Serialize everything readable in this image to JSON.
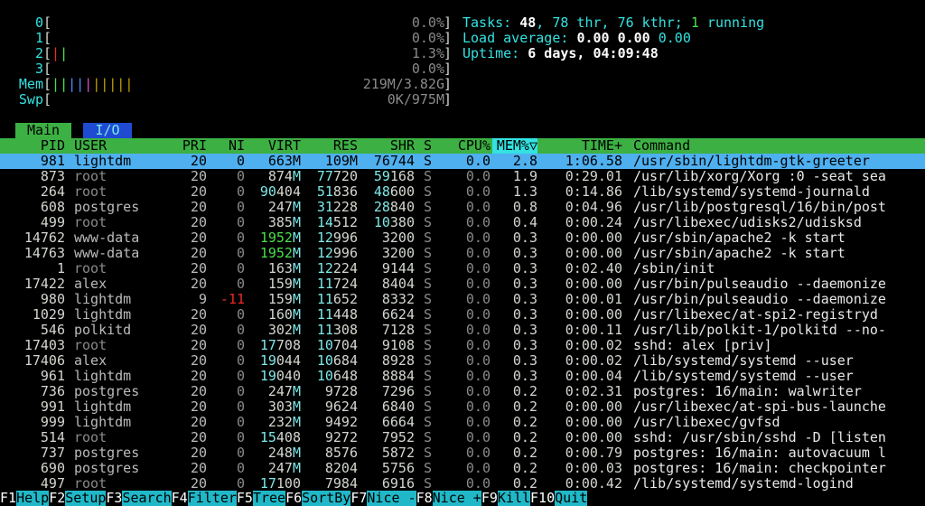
{
  "cpu_meters": [
    {
      "label": "0",
      "percent": "0.0%"
    },
    {
      "label": "1",
      "percent": "0.0%"
    },
    {
      "label": "2",
      "percent": "1.3%"
    },
    {
      "label": "3",
      "percent": "0.0%"
    }
  ],
  "mem_meter": {
    "label": "Mem",
    "value": "219M/3.82G"
  },
  "swp_meter": {
    "label": "Swp",
    "value": "0K/975M"
  },
  "tasks": {
    "label": "Tasks: ",
    "tasks": "48",
    "sep1": ", ",
    "threads": "78 thr, 76 kthr; ",
    "running": "1",
    "running_label": " running"
  },
  "load": {
    "label": "Load average: ",
    "l1": "0.00",
    "l5": "0.00",
    "l15": "0.00"
  },
  "uptime": {
    "label": "Uptime: ",
    "value": "6 days, 04:09:48"
  },
  "tabs": [
    {
      "label": "Main"
    },
    {
      "label": "I/O"
    }
  ],
  "columns": [
    "PID",
    "USER",
    "PRI",
    "NI",
    "VIRT",
    "RES",
    "SHR",
    "S",
    "CPU%",
    "MEM%▽",
    "TIME+",
    "Command"
  ],
  "processes": [
    {
      "pid": "981",
      "user": "lightdm",
      "pri": "20",
      "ni": "0",
      "virt": "663M",
      "res": "109M",
      "shr": "76744",
      "s": "S",
      "cpu": "0.0",
      "mem": "2.8",
      "time": "1:06.58",
      "cmd": "/usr/sbin/lightdm-gtk-greeter",
      "selected": true
    },
    {
      "pid": "873",
      "user": "root",
      "pri": "20",
      "ni": "0",
      "virt": "874M",
      "res": "77720",
      "shr": "59168",
      "s": "S",
      "cpu": "0.0",
      "mem": "1.9",
      "time": "0:29.01",
      "cmd": "/usr/lib/xorg/Xorg :0 -seat sea"
    },
    {
      "pid": "264",
      "user": "root",
      "pri": "20",
      "ni": "0",
      "virt": "90404",
      "res": "51836",
      "shr": "48600",
      "s": "S",
      "cpu": "0.0",
      "mem": "1.3",
      "time": "0:14.86",
      "cmd": "/lib/systemd/systemd-journald"
    },
    {
      "pid": "608",
      "user": "postgres",
      "pri": "20",
      "ni": "0",
      "virt": "247M",
      "res": "31228",
      "shr": "28840",
      "s": "S",
      "cpu": "0.0",
      "mem": "0.8",
      "time": "0:04.96",
      "cmd": "/usr/lib/postgresql/16/bin/post"
    },
    {
      "pid": "499",
      "user": "root",
      "pri": "20",
      "ni": "0",
      "virt": "385M",
      "res": "14512",
      "shr": "10380",
      "s": "S",
      "cpu": "0.0",
      "mem": "0.4",
      "time": "0:00.24",
      "cmd": "/usr/libexec/udisks2/udisksd"
    },
    {
      "pid": "14762",
      "user": "www-data",
      "pri": "20",
      "ni": "0",
      "virt": "1952M",
      "res": "12996",
      "shr": "3200",
      "s": "S",
      "cpu": "0.0",
      "mem": "0.3",
      "time": "0:00.00",
      "cmd": "/usr/sbin/apache2 -k start"
    },
    {
      "pid": "14763",
      "user": "www-data",
      "pri": "20",
      "ni": "0",
      "virt": "1952M",
      "res": "12996",
      "shr": "3200",
      "s": "S",
      "cpu": "0.0",
      "mem": "0.3",
      "time": "0:00.00",
      "cmd": "/usr/sbin/apache2 -k start"
    },
    {
      "pid": "1",
      "user": "root",
      "pri": "20",
      "ni": "0",
      "virt": "163M",
      "res": "12224",
      "shr": "9144",
      "s": "S",
      "cpu": "0.0",
      "mem": "0.3",
      "time": "0:02.40",
      "cmd": "/sbin/init"
    },
    {
      "pid": "17422",
      "user": "alex",
      "pri": "20",
      "ni": "0",
      "virt": "159M",
      "res": "11724",
      "shr": "8404",
      "s": "S",
      "cpu": "0.0",
      "mem": "0.3",
      "time": "0:00.00",
      "cmd": "/usr/bin/pulseaudio --daemonize"
    },
    {
      "pid": "980",
      "user": "lightdm",
      "pri": "9",
      "ni": "-11",
      "virt": "159M",
      "res": "11652",
      "shr": "8332",
      "s": "S",
      "cpu": "0.0",
      "mem": "0.3",
      "time": "0:00.01",
      "cmd": "/usr/bin/pulseaudio --daemonize"
    },
    {
      "pid": "1029",
      "user": "lightdm",
      "pri": "20",
      "ni": "0",
      "virt": "160M",
      "res": "11448",
      "shr": "6624",
      "s": "S",
      "cpu": "0.0",
      "mem": "0.3",
      "time": "0:00.00",
      "cmd": "/usr/libexec/at-spi2-registryd"
    },
    {
      "pid": "546",
      "user": "polkitd",
      "pri": "20",
      "ni": "0",
      "virt": "302M",
      "res": "11308",
      "shr": "7128",
      "s": "S",
      "cpu": "0.0",
      "mem": "0.3",
      "time": "0:00.11",
      "cmd": "/usr/lib/polkit-1/polkitd --no-"
    },
    {
      "pid": "17403",
      "user": "root",
      "pri": "20",
      "ni": "0",
      "virt": "17708",
      "res": "10704",
      "shr": "9108",
      "s": "S",
      "cpu": "0.0",
      "mem": "0.3",
      "time": "0:00.02",
      "cmd": "sshd: alex [priv]"
    },
    {
      "pid": "17406",
      "user": "alex",
      "pri": "20",
      "ni": "0",
      "virt": "19044",
      "res": "10684",
      "shr": "8928",
      "s": "S",
      "cpu": "0.0",
      "mem": "0.3",
      "time": "0:00.02",
      "cmd": "/lib/systemd/systemd --user"
    },
    {
      "pid": "961",
      "user": "lightdm",
      "pri": "20",
      "ni": "0",
      "virt": "19040",
      "res": "10648",
      "shr": "8884",
      "s": "S",
      "cpu": "0.0",
      "mem": "0.3",
      "time": "0:00.04",
      "cmd": "/lib/systemd/systemd --user"
    },
    {
      "pid": "736",
      "user": "postgres",
      "pri": "20",
      "ni": "0",
      "virt": "247M",
      "res": "9728",
      "shr": "7296",
      "s": "S",
      "cpu": "0.0",
      "mem": "0.2",
      "time": "0:02.31",
      "cmd": "postgres: 16/main: walwriter"
    },
    {
      "pid": "991",
      "user": "lightdm",
      "pri": "20",
      "ni": "0",
      "virt": "303M",
      "res": "9624",
      "shr": "6840",
      "s": "S",
      "cpu": "0.0",
      "mem": "0.2",
      "time": "0:00.00",
      "cmd": "/usr/libexec/at-spi-bus-launche"
    },
    {
      "pid": "999",
      "user": "lightdm",
      "pri": "20",
      "ni": "0",
      "virt": "232M",
      "res": "9492",
      "shr": "6664",
      "s": "S",
      "cpu": "0.0",
      "mem": "0.2",
      "time": "0:00.00",
      "cmd": "/usr/libexec/gvfsd"
    },
    {
      "pid": "514",
      "user": "root",
      "pri": "20",
      "ni": "0",
      "virt": "15408",
      "res": "9272",
      "shr": "7952",
      "s": "S",
      "cpu": "0.0",
      "mem": "0.2",
      "time": "0:00.00",
      "cmd": "sshd: /usr/sbin/sshd -D [listen"
    },
    {
      "pid": "737",
      "user": "postgres",
      "pri": "20",
      "ni": "0",
      "virt": "248M",
      "res": "8576",
      "shr": "5872",
      "s": "S",
      "cpu": "0.0",
      "mem": "0.2",
      "time": "0:00.79",
      "cmd": "postgres: 16/main: autovacuum l"
    },
    {
      "pid": "690",
      "user": "postgres",
      "pri": "20",
      "ni": "0",
      "virt": "247M",
      "res": "8204",
      "shr": "5756",
      "s": "S",
      "cpu": "0.0",
      "mem": "0.2",
      "time": "0:00.03",
      "cmd": "postgres: 16/main: checkpointer"
    },
    {
      "pid": "497",
      "user": "root",
      "pri": "20",
      "ni": "0",
      "virt": "17100",
      "res": "7984",
      "shr": "6916",
      "s": "S",
      "cpu": "0.0",
      "mem": "0.2",
      "time": "0:00.42",
      "cmd": "/lib/systemd/systemd-logind"
    }
  ],
  "function_keys": [
    {
      "key": "F1",
      "label": "Help"
    },
    {
      "key": "F2",
      "label": "Setup"
    },
    {
      "key": "F3",
      "label": "Search"
    },
    {
      "key": "F4",
      "label": "Filter"
    },
    {
      "key": "F5",
      "label": "Tree"
    },
    {
      "key": "F6",
      "label": "SortBy"
    },
    {
      "key": "F7",
      "label": "Nice -"
    },
    {
      "key": "F8",
      "label": "Nice +"
    },
    {
      "key": "F9",
      "label": "Kill"
    },
    {
      "key": "F10",
      "label": "Quit"
    }
  ],
  "colors": {
    "header_bg": "#3cb043",
    "selected_bg": "#4fb0f0",
    "fkey_bg": "#20b8c8",
    "tab_io_bg": "#1e4bd2",
    "cyan": "#34e2e2"
  }
}
